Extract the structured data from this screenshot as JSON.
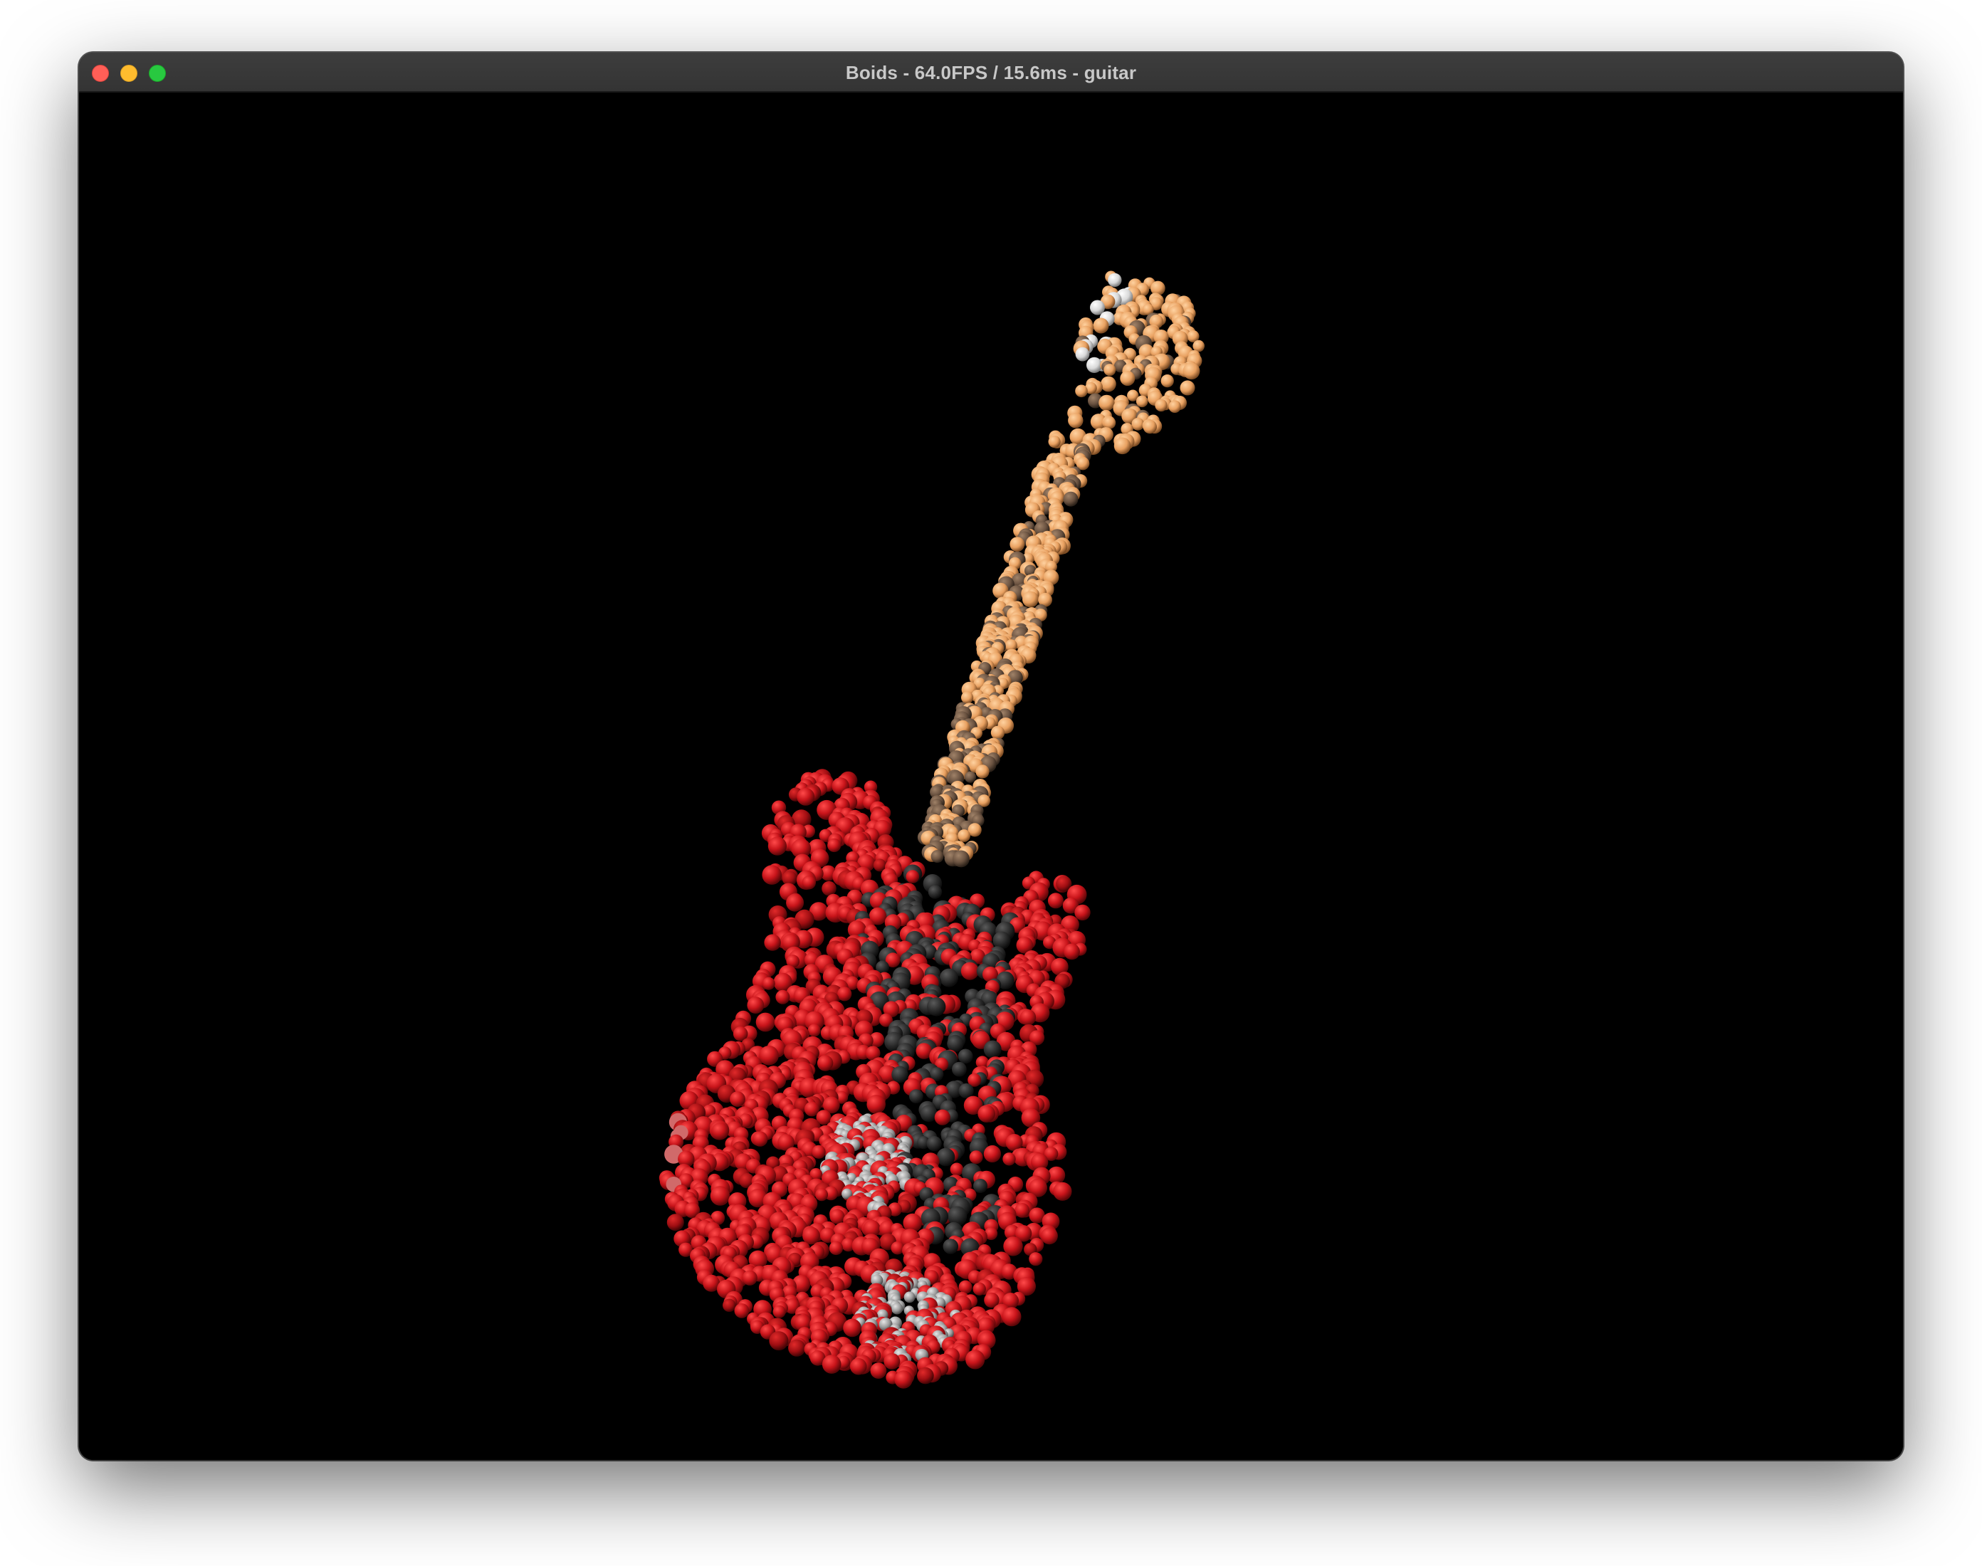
{
  "window": {
    "title": "Boids - 64.0FPS / 15.6ms - guitar"
  },
  "scene": {
    "model": "guitar",
    "background_color": "#000000",
    "colors": {
      "body": "#c8141a",
      "body_dark": "#7a0b0f",
      "body_highlight": "#ff5a5a",
      "pickguard": "#2a2a2a",
      "pickup": "#9a9a9a",
      "neck": "#f0a868",
      "neck_dark": "#7a5a40",
      "headstock_tuner": "#ffffff"
    }
  }
}
